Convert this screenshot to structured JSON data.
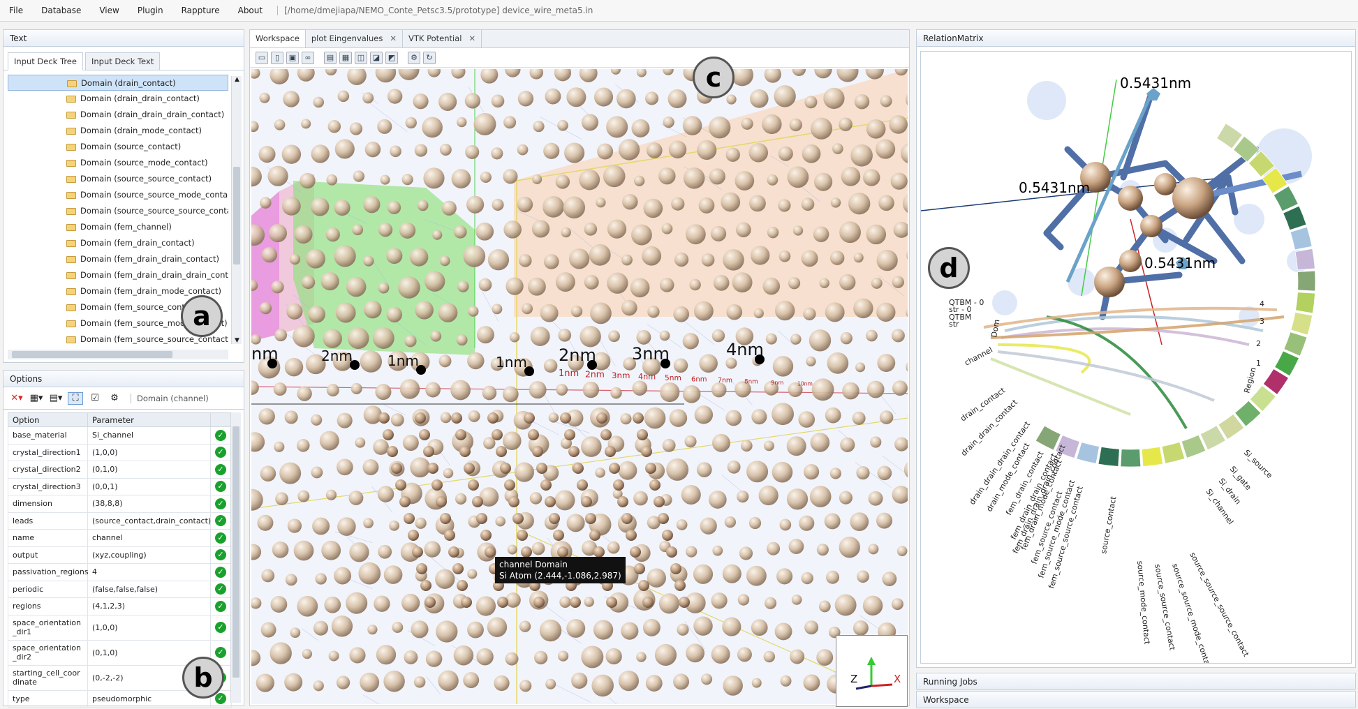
{
  "menubar": {
    "items": [
      "File",
      "Database",
      "View",
      "Plugin",
      "Rappture",
      "About"
    ],
    "path": "[/home/dmejiapa/NEMO_Conte_Petsc3.5/prototype] device_wire_meta5.in"
  },
  "text_panel": {
    "title": "Text",
    "tabs": [
      "Input Deck Tree",
      "Input Deck Text"
    ],
    "tree_items": [
      "Domain (drain_contact)",
      "Domain (drain_drain_contact)",
      "Domain (drain_drain_drain_contact)",
      "Domain (drain_mode_contact)",
      "Domain (source_contact)",
      "Domain (source_mode_contact)",
      "Domain (source_source_contact)",
      "Domain (source_source_mode_contact",
      "Domain (source_source_source_contac",
      "Domain (fem_channel)",
      "Domain (fem_drain_contact)",
      "Domain (fem_drain_drain_contact)",
      "Domain (fem_drain_drain_drain_conta",
      "Domain (fem_drain_mode_contact)",
      "Domain (fem_source_contact)",
      "Domain (fem_source_mode_contact)",
      "Domain (fem_source_source_contact)"
    ],
    "badge": "a"
  },
  "options_panel": {
    "title": "Options",
    "domain_label": "Domain (channel)",
    "col_option": "Option",
    "col_param": "Parameter",
    "rows": [
      [
        "base_material",
        "Si_channel"
      ],
      [
        "crystal_direction1",
        "(1,0,0)"
      ],
      [
        "crystal_direction2",
        "(0,1,0)"
      ],
      [
        "crystal_direction3",
        "(0,0,1)"
      ],
      [
        "dimension",
        "(38,8,8)"
      ],
      [
        "leads",
        "(source_contact,drain_contact)"
      ],
      [
        "name",
        "channel"
      ],
      [
        "output",
        "(xyz,coupling)"
      ],
      [
        "passivation_regions",
        "4"
      ],
      [
        "periodic",
        "(false,false,false)"
      ],
      [
        "regions",
        "(4,1,2,3)"
      ],
      [
        "space_orientation_dir1",
        "(1,0,0)"
      ],
      [
        "space_orientation_dir2",
        "(0,1,0)"
      ],
      [
        "starting_cell_coordinate",
        "(0,-2,-2)"
      ],
      [
        "type",
        "pseudomorphic"
      ]
    ],
    "badge": "b"
  },
  "workspace": {
    "tabs": [
      "Workspace",
      "plot Eingenvalues",
      "VTK Potential"
    ],
    "badge": "c",
    "tooltip_line1": "channel Domain",
    "tooltip_line2": "Si Atom (2.444,-1.086,2.987)",
    "scale_labels": [
      "nm",
      "2nm",
      "1nm",
      "1nm",
      "2nm",
      "3nm",
      "4nm"
    ],
    "small_labels": [
      "1nm",
      "2nm",
      "3nm",
      "4nm",
      "5nm",
      "6nm",
      "7nm",
      "8nm",
      "9nm",
      "10nm"
    ],
    "axes": {
      "z": "Z",
      "x": "X"
    }
  },
  "relation_matrix": {
    "title": "RelationMatrix",
    "badge": "d",
    "labels": [
      "0.5431nm",
      "0.5431nm",
      "0.5431nm"
    ],
    "chord_labels": [
      "channel",
      "drain_contact",
      "drain_drain_contact",
      "drain_drain_drain_contact",
      "drain_mode_contact",
      "fem_drain_contact",
      "fem_drain_drain_contact",
      "fem_drain_drain_drain_contact",
      "fem_drain_mode_contact",
      "fem_source_contact",
      "fem_source_mode_contact",
      "fem_source_source_contact",
      "source_contact",
      "source_mode_contact",
      "source_source_contact",
      "source_source_mode_contact",
      "source_source_source_contact",
      "Si_channel",
      "Si_drain",
      "Si_gate",
      "Si_source",
      "Region",
      "1",
      "2",
      "3",
      "4",
      "QTBM - 0",
      "str - 0",
      "QTBM",
      "str",
      "Dom"
    ]
  },
  "bottom": {
    "running": "Running Jobs",
    "workspace": "Workspace"
  }
}
